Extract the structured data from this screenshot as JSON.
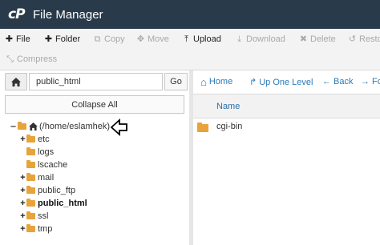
{
  "app": {
    "logo": "cP",
    "title": "File Manager"
  },
  "toolbar": {
    "row1": [
      {
        "label": "File",
        "icon": "plus-icon",
        "glyph": "✚",
        "enabled": true
      },
      {
        "label": "Folder",
        "icon": "plus-icon",
        "glyph": "✚",
        "enabled": true
      },
      {
        "label": "Copy",
        "icon": "copy-icon",
        "glyph": "⧉",
        "enabled": false
      },
      {
        "label": "Move",
        "icon": "move-icon",
        "glyph": "✥",
        "enabled": false
      },
      {
        "label": "Upload",
        "icon": "upload-icon",
        "glyph": "⤒",
        "enabled": true
      },
      {
        "label": "Download",
        "icon": "download-icon",
        "glyph": "⤓",
        "enabled": false
      },
      {
        "label": "Delete",
        "icon": "delete-icon",
        "glyph": "✖",
        "enabled": false
      },
      {
        "label": "Resto",
        "icon": "restore-icon",
        "glyph": "↺",
        "enabled": false
      }
    ],
    "row2": [
      {
        "label": "Compress",
        "icon": "compress-icon",
        "glyph": "⤡",
        "enabled": false
      }
    ]
  },
  "left": {
    "path_value": "public_html",
    "go_label": "Go",
    "collapse_label": "Collapse All"
  },
  "tree": [
    {
      "label": "(/home/eslamhek)",
      "expander": "‒",
      "depth": 0,
      "icon": "home-icon",
      "bold": false
    },
    {
      "label": "etc",
      "expander": "+",
      "depth": 1,
      "icon": "folder-icon",
      "bold": false
    },
    {
      "label": "logs",
      "expander": "",
      "depth": 1,
      "icon": "folder-icon",
      "bold": false
    },
    {
      "label": "lscache",
      "expander": "",
      "depth": 1,
      "icon": "folder-icon",
      "bold": false
    },
    {
      "label": "mail",
      "expander": "+",
      "depth": 1,
      "icon": "folder-icon",
      "bold": false
    },
    {
      "label": "public_ftp",
      "expander": "+",
      "depth": 1,
      "icon": "folder-icon",
      "bold": false
    },
    {
      "label": "public_html",
      "expander": "+",
      "depth": 1,
      "icon": "folder-icon",
      "bold": true
    },
    {
      "label": "ssl",
      "expander": "+",
      "depth": 1,
      "icon": "folder-icon",
      "bold": false
    },
    {
      "label": "tmp",
      "expander": "+",
      "depth": 1,
      "icon": "folder-icon",
      "bold": false
    }
  ],
  "right": {
    "nav": [
      {
        "label": "Home",
        "icon": "home-icon",
        "glyph": "⌂"
      },
      {
        "label": "Up One Level",
        "icon": "level-up-icon",
        "glyph": "↱"
      },
      {
        "label": "Back",
        "icon": "arrow-left-icon",
        "glyph": "←"
      },
      {
        "label": "Fo",
        "icon": "arrow-right-icon",
        "glyph": "→"
      }
    ],
    "column_name": "Name",
    "files": [
      {
        "name": "cgi-bin",
        "icon": "folder-icon"
      }
    ]
  },
  "colors": {
    "titlebar": "#293a4a",
    "folder": "#e8a33a",
    "link": "#2a7ab8"
  }
}
